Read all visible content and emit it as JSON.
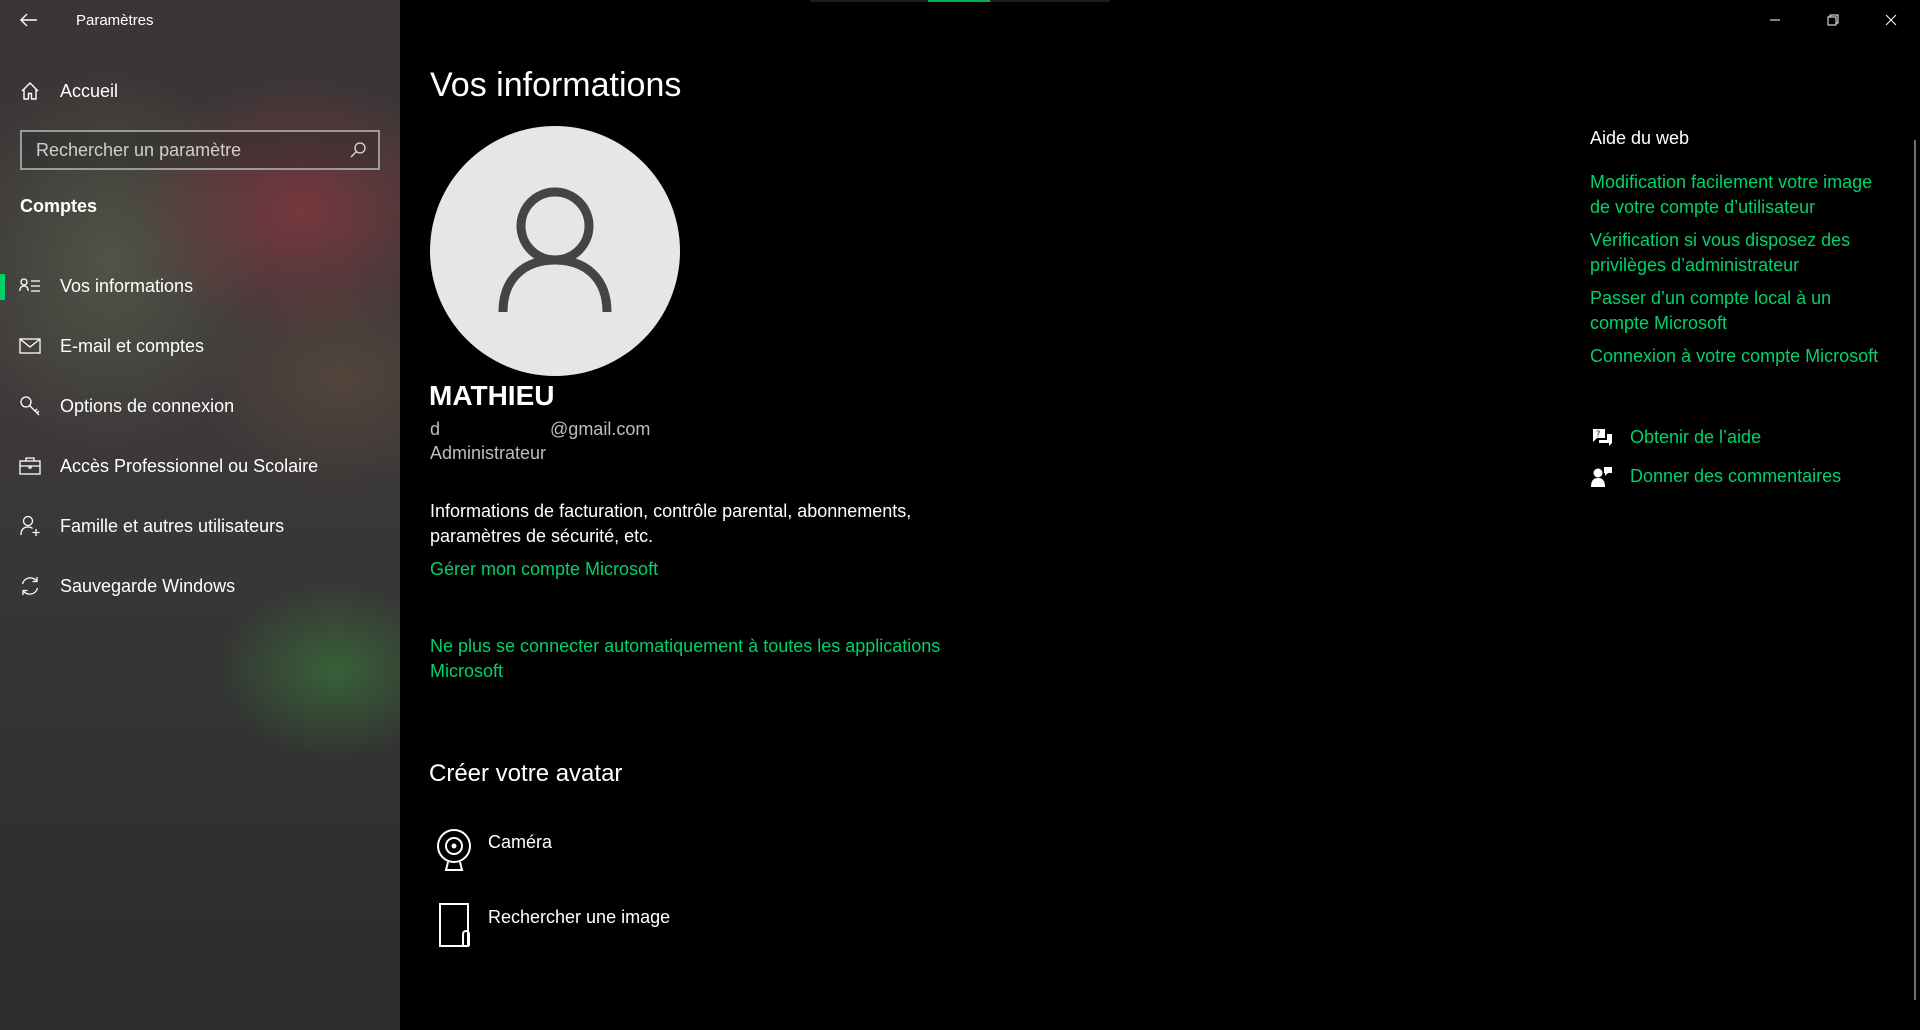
{
  "window": {
    "title": "Paramètres",
    "controls": [
      "minimize",
      "restore",
      "close"
    ]
  },
  "sidebar": {
    "home_label": "Accueil",
    "search_placeholder": "Rechercher un paramètre",
    "section_header": "Comptes",
    "items": [
      {
        "label": "Vos informations",
        "icon": "person-list-icon",
        "active": true
      },
      {
        "label": "E-mail et comptes",
        "icon": "mail-icon",
        "active": false
      },
      {
        "label": "Options de connexion",
        "icon": "key-icon",
        "active": false
      },
      {
        "label": "Accès Professionnel ou Scolaire",
        "icon": "briefcase-icon",
        "active": false
      },
      {
        "label": "Famille et autres utilisateurs",
        "icon": "person-add-icon",
        "active": false
      },
      {
        "label": "Sauvegarde Windows",
        "icon": "sync-icon",
        "active": false
      }
    ]
  },
  "main": {
    "title": "Vos informations",
    "user": {
      "name": "MATHIEU",
      "email": "d                      @gmail.com",
      "role": "Administrateur"
    },
    "billing_text": "Informations de facturation, contrôle parental, abonnements, paramètres de sécurité, etc.",
    "manage_link": "Gérer mon compte Microsoft",
    "stop_signin_link": "Ne plus se connecter automatiquement à toutes les applications Microsoft",
    "avatar_heading": "Créer votre avatar",
    "avatar_options": [
      {
        "label": "Caméra",
        "icon": "camera-icon"
      },
      {
        "label": "Rechercher une image",
        "icon": "browse-image-icon"
      }
    ]
  },
  "help": {
    "title": "Aide du web",
    "links": [
      "Modification facilement votre image de votre compte d’utilisateur",
      "Vérification si vous disposez des privilèges d’administrateur",
      "Passer d’un compte local à un compte Microsoft",
      "Connexion à votre compte Microsoft"
    ],
    "get_help": "Obtenir de l’aide",
    "feedback": "Donner des commentaires"
  },
  "colors": {
    "accent": "#00d26a",
    "background": "#000000",
    "text": "#ffffff",
    "muted_text": "#bdbdbd",
    "avatar_bg": "#e6e6e6"
  }
}
